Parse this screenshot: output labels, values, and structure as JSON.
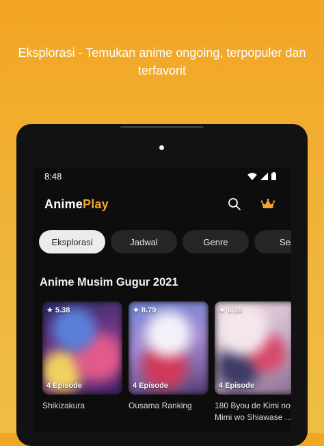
{
  "headline": {
    "line1": "Eksplorasi - Temukan anime ongoing, terpopuler dan",
    "line2": "terfavorit"
  },
  "status_bar": {
    "time": "8:48",
    "icons": [
      "wifi-icon",
      "signal-icon",
      "battery-icon"
    ]
  },
  "app": {
    "logo_part1": "Anime",
    "logo_part2": "Play",
    "accent": "#f4a62a",
    "header_icons": [
      "search-icon",
      "crown-icon"
    ]
  },
  "tabs": [
    {
      "label": "Eksplorasi",
      "active": true
    },
    {
      "label": "Jadwal",
      "active": false
    },
    {
      "label": "Genre",
      "active": false
    },
    {
      "label": "Sea",
      "active": false
    }
  ],
  "section": {
    "title": "Anime Musim Gugur 2021"
  },
  "cards": [
    {
      "rating": "★ 5.38",
      "episodes": "4 Episode",
      "title": "Shikizakura",
      "subtitle": ""
    },
    {
      "rating": "★ 8.79",
      "episodes": "4 Episode",
      "title": "Ousama Ranking",
      "subtitle": ""
    },
    {
      "rating": "★ 6.18",
      "episodes": "4 Episode",
      "title": "180 Byou de Kimi no",
      "subtitle": "Mimi wo Shiawase ..."
    }
  ]
}
